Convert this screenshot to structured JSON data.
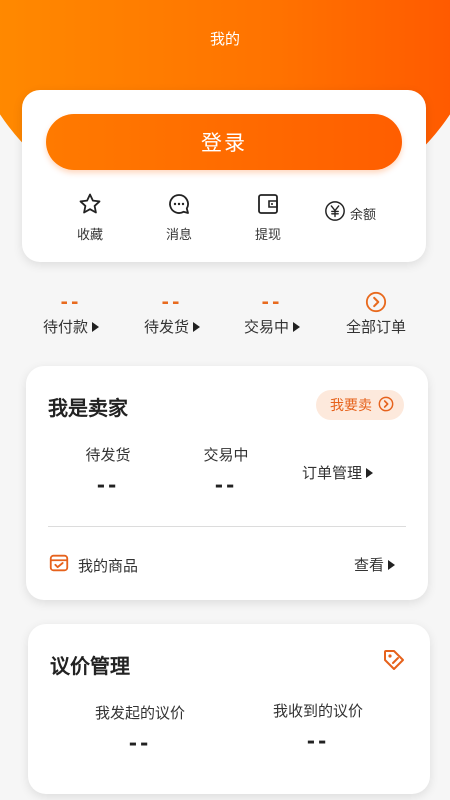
{
  "header": {
    "title": "我的"
  },
  "login": {
    "button_label": "登录"
  },
  "quick_actions": [
    {
      "label": "收藏",
      "icon": "star-icon"
    },
    {
      "label": "消息",
      "icon": "message-icon"
    },
    {
      "label": "提现",
      "icon": "wallet-icon"
    },
    {
      "label": "余额",
      "icon": "yen-icon"
    }
  ],
  "orders": {
    "items": [
      {
        "label": "待付款",
        "count": "--"
      },
      {
        "label": "待发货",
        "count": "--"
      },
      {
        "label": "交易中",
        "count": "--"
      },
      {
        "label": "全部订单"
      }
    ]
  },
  "seller": {
    "title": "我是卖家",
    "sell_button": "我要卖",
    "stats": [
      {
        "label": "待发货",
        "value": "--"
      },
      {
        "label": "交易中",
        "value": "--"
      }
    ],
    "order_manage": "订单管理",
    "my_goods": "我的商品",
    "view": "查看"
  },
  "bargain": {
    "title": "议价管理",
    "stats": [
      {
        "label": "我发起的议价",
        "value": "--"
      },
      {
        "label": "我收到的议价",
        "value": "--"
      }
    ]
  },
  "colors": {
    "accent": "#ff6a00",
    "accent_text": "#e6621c",
    "pill_bg": "#fde9dc"
  }
}
